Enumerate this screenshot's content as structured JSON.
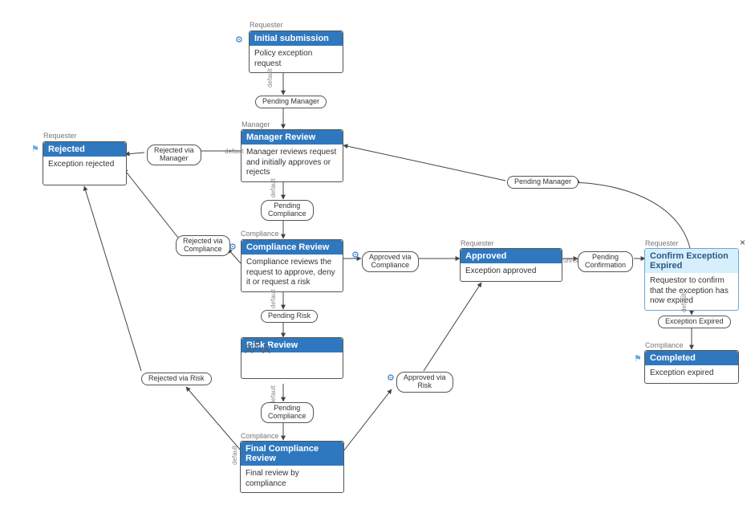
{
  "chart_data": {
    "type": "diagram",
    "title": "",
    "nodes": [
      {
        "id": "initial",
        "role": "Requester",
        "title": "Initial submission",
        "body": "Policy exception request"
      },
      {
        "id": "rejected",
        "role": "Requester",
        "title": "Rejected",
        "body": "Exception rejected"
      },
      {
        "id": "manager",
        "role": "Manager",
        "title": "Manager Review",
        "body": "Manager reviews request and initially approves or rejects"
      },
      {
        "id": "compliance",
        "role": "Compliance",
        "title": "Compliance Review",
        "body": "Compliance reviews the request to approve, deny it or request a risk"
      },
      {
        "id": "approved",
        "role": "Requester",
        "title": "Approved",
        "body": "Exception approved"
      },
      {
        "id": "confirm",
        "role": "Requester",
        "title": "Confirm Exception Expired",
        "body": "Requestor to confirm that the exception has now expired"
      },
      {
        "id": "risk",
        "role": "",
        "title": "Risk Review",
        "body": ""
      },
      {
        "id": "completed",
        "role": "Compliance",
        "title": "Completed",
        "body": "Exception expired"
      },
      {
        "id": "final",
        "role": "Compliance",
        "title": "Final Compliance Review",
        "body": "Final review by compliance"
      }
    ],
    "edges": [
      {
        "from": "initial",
        "to": "manager",
        "label": "Pending Manager"
      },
      {
        "from": "manager",
        "to": "rejected",
        "label": "Rejected via Manager"
      },
      {
        "from": "manager",
        "to": "compliance",
        "label": "Pending Compliance"
      },
      {
        "from": "compliance",
        "to": "rejected",
        "label": "Rejected via Compliance"
      },
      {
        "from": "compliance",
        "to": "approved",
        "label": "Approved via Compliance"
      },
      {
        "from": "compliance",
        "to": "risk",
        "label": "Pending Risk"
      },
      {
        "from": "approved",
        "to": "confirm",
        "label": "Pending Confirmation"
      },
      {
        "from": "confirm",
        "to": "manager",
        "label": "Pending Manager"
      },
      {
        "from": "confirm",
        "to": "completed",
        "label": "Exception Expired"
      },
      {
        "from": "risk",
        "to": "final",
        "label": "Pending Compliance"
      },
      {
        "from": "final",
        "to": "approved",
        "label": "Approved via Risk"
      },
      {
        "from": "final",
        "to": "rejected",
        "label": "Rejected via Risk"
      }
    ]
  },
  "roles": {
    "initial": "Requester",
    "rejected": "Requester",
    "manager": "Manager",
    "compliance": "Compliance",
    "approved": "Requester",
    "confirm": "Requester",
    "completed": "Compliance",
    "final": "Compliance"
  },
  "nodes": {
    "initial": {
      "title": "Initial submission",
      "body": "Policy exception request"
    },
    "rejected": {
      "title": "Rejected",
      "body": "Exception rejected"
    },
    "manager": {
      "title": "Manager Review",
      "body": "Manager reviews request and initially approves or rejects"
    },
    "compliance": {
      "title": "Compliance Review",
      "body": "Compliance reviews the request to approve, deny it or request a risk"
    },
    "approved": {
      "title": "Approved",
      "body": "Exception approved"
    },
    "confirm": {
      "title": "Confirm Exception Expired",
      "body": "Requestor to confirm that the exception has now expired"
    },
    "risk": {
      "title": "Risk Review",
      "body": ""
    },
    "completed": {
      "title": "Completed",
      "body": "Exception expired"
    },
    "final": {
      "title": "Final Compliance Review",
      "body": "Final review by compliance"
    }
  },
  "edges": {
    "pending_manager_1": "Pending Manager",
    "rejected_via_manager": "Rejected via\nManager",
    "pending_compliance_1": "Pending\nCompliance",
    "rejected_via_compliance": "Rejected via\nCompliance",
    "approved_via_compliance": "Approved via\nCompliance",
    "pending_risk": "Pending Risk",
    "pending_confirmation": "Pending\nConfirmation",
    "pending_manager_2": "Pending Manager",
    "exception_expired": "Exception Expired",
    "pending_compliance_2": "Pending\nCompliance",
    "approved_via_risk": "Approved via\nRisk",
    "rejected_via_risk": "Rejected via Risk"
  },
  "misc": {
    "default": "default",
    "unread": "unread",
    "close": "×"
  }
}
